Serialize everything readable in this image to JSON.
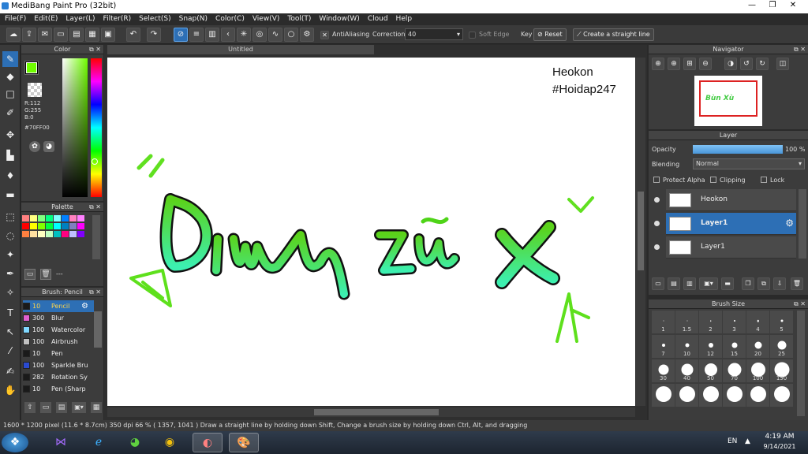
{
  "window": {
    "title": "MediBang Paint Pro (32bit)"
  },
  "menu": [
    "File(F)",
    "Edit(E)",
    "Layer(L)",
    "Filter(R)",
    "Select(S)",
    "Snap(N)",
    "Color(C)",
    "View(V)",
    "Tool(T)",
    "Window(W)",
    "Cloud",
    "Help"
  ],
  "toolbar": {
    "antialias_label": "AntiAliasing",
    "correction_label": "Correction",
    "correction_value": "40",
    "soft_edge_label": "Soft Edge",
    "key_label": "Key",
    "reset_label": "Reset",
    "straight_line_label": "Create a straight line"
  },
  "color_panel": {
    "title": "Color",
    "r": "R:112",
    "g": "G:255",
    "b": "B:0",
    "hex": "#70FF00",
    "fg_color": "#70FF00"
  },
  "palette_panel": {
    "title": "Palette",
    "footer": "---"
  },
  "brush_panel": {
    "title": "Brush: Pencil",
    "items": [
      {
        "size": "10",
        "name": "Pencil",
        "color": "#1a1a1a"
      },
      {
        "size": "300",
        "name": "Blur",
        "color": "#e060d0"
      },
      {
        "size": "100",
        "name": "Watercolor",
        "color": "#80d8ff"
      },
      {
        "size": "100",
        "name": "Airbrush",
        "color": "#c0c0c0"
      },
      {
        "size": "10",
        "name": "Pen",
        "color": "#1a1a1a"
      },
      {
        "size": "100",
        "name": "Sparkle Bru",
        "color": "#2a4ad0"
      },
      {
        "size": "282",
        "name": "Rotation Sy",
        "color": "#1a1a1a"
      },
      {
        "size": "10",
        "name": "Pen (Sharp",
        "color": "#1a1a1a"
      }
    ]
  },
  "canvas": {
    "tab_title": "Untitled",
    "watermark_line1": "Heokon",
    "watermark_line2": "#Hoidap247",
    "art_text": "Bùn Xù"
  },
  "navigator": {
    "title": "Navigator"
  },
  "layer_panel": {
    "title": "Layer",
    "opacity_label": "Opacity",
    "opacity_value": "100 %",
    "opacity_fraction": 1.0,
    "blending_label": "Blending",
    "blending_value": "Normal",
    "protect_alpha": "Protect Alpha",
    "clipping": "Clipping",
    "lock": "Lock",
    "layers": [
      {
        "name": "Heokon",
        "selected": false
      },
      {
        "name": "Layer1",
        "selected": true
      },
      {
        "name": "Layer1",
        "selected": false
      }
    ]
  },
  "brush_size_panel": {
    "title": "Brush Size",
    "sizes": [
      "1",
      "1.5",
      "2",
      "3",
      "4",
      "5",
      "7",
      "10",
      "12",
      "15",
      "20",
      "25",
      "30",
      "40",
      "50",
      "70",
      "100",
      "150",
      "",
      "",
      "",
      "",
      "",
      ""
    ]
  },
  "status": {
    "pixels": "1600 * 1200 pixel",
    "cm": "(11.6 * 8.7cm)",
    "dpi": "350 dpi",
    "zoom": "66 %",
    "coords": "( 1357, 1041 )",
    "hint": "Draw a straight line by holding down Shift, Change a brush size by holding down Ctrl, Alt, and dragging"
  },
  "taskbar": {
    "lang": "EN",
    "time": "4:19 AM",
    "date": "9/14/2021"
  }
}
